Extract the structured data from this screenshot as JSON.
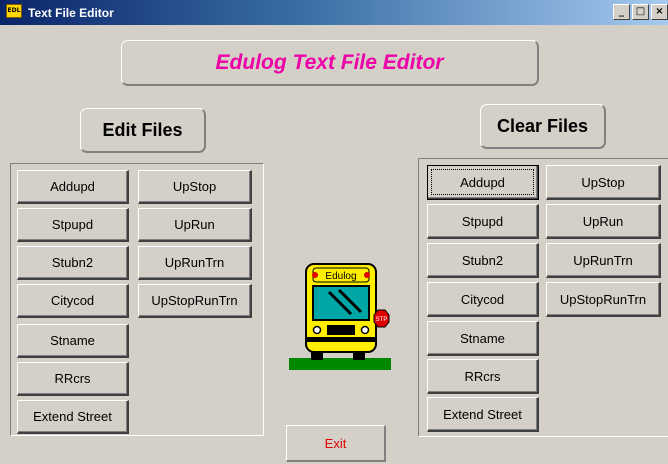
{
  "window": {
    "title": "Text File Editor",
    "icon": "edulog-app-icon",
    "minimize_label": "_",
    "maximize_label": "□",
    "close_label": "×"
  },
  "banner": {
    "title": "Edulog Text File Editor",
    "color": "#ee00a8"
  },
  "edit_files": {
    "heading": "Edit Files",
    "left_column": [
      "Addupd",
      "Stpupd",
      "Stubn2",
      "Citycod",
      "Stname",
      "RRcrs",
      "Extend Street"
    ],
    "right_column": [
      "UpStop",
      "UpRun",
      "UpRunTrn",
      "UpStopRunTrn"
    ]
  },
  "clear_files": {
    "heading": "Clear Files",
    "left_column": [
      "Addupd",
      "Stpupd",
      "Stubn2",
      "Citycod",
      "Stname",
      "RRcrs",
      "Extend Street"
    ],
    "right_column": [
      "UpStop",
      "UpRun",
      "UpRunTrn",
      "UpStopRunTrn"
    ]
  },
  "bus_logo": {
    "sign_text": "Edulog",
    "stop_sign_text": "STP",
    "bus_color": "#ffee00",
    "ground_color": "#008800"
  },
  "exit": {
    "label": "Exit",
    "color": "#e00000"
  }
}
